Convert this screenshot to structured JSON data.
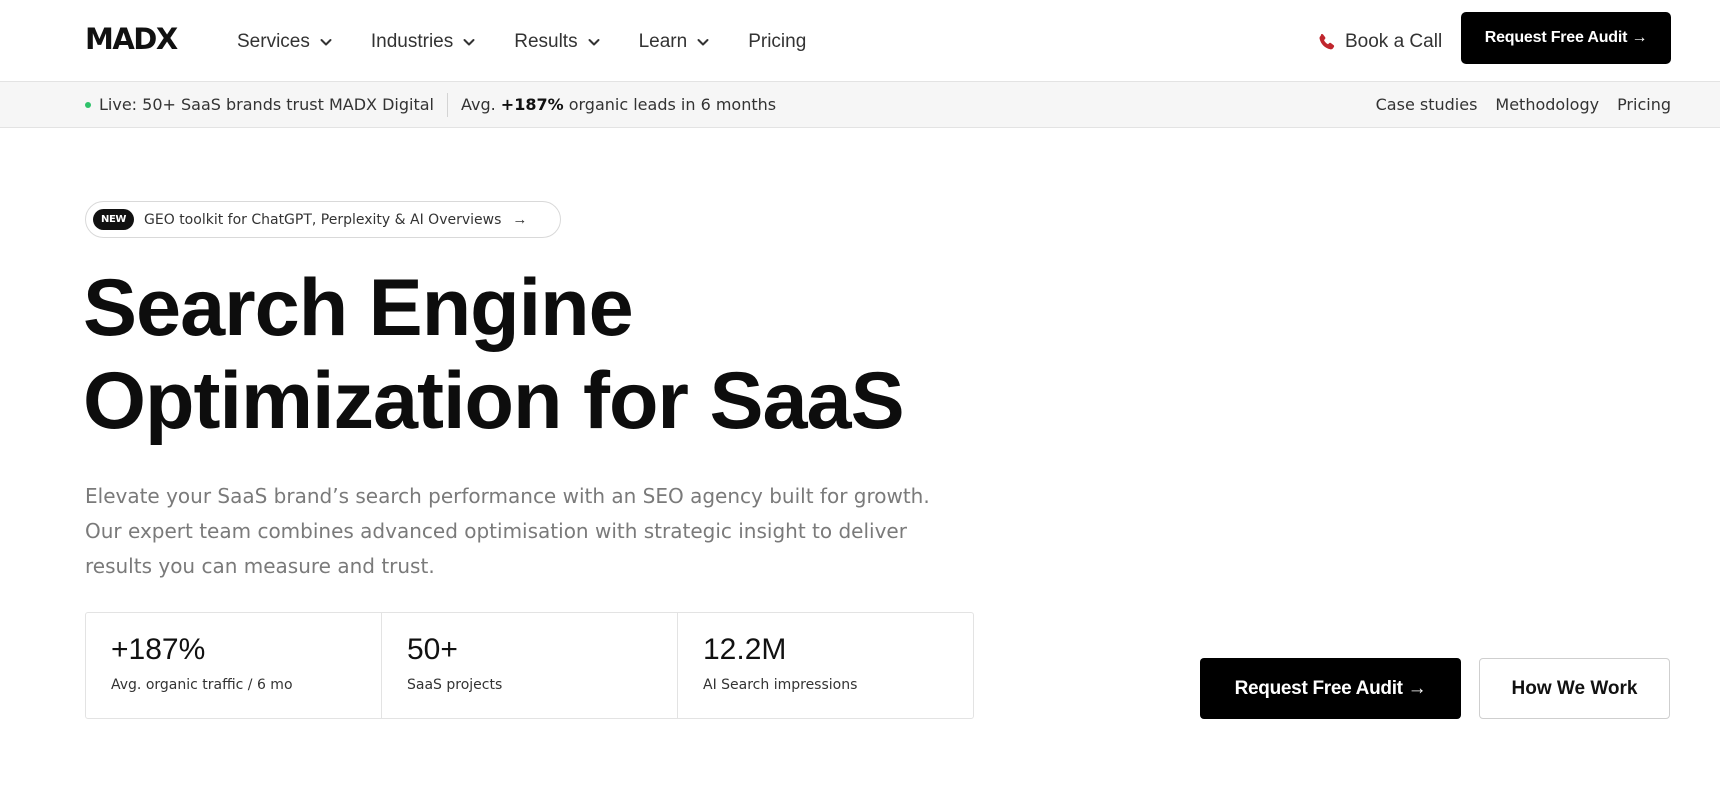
{
  "nav": {
    "logo": "MADX",
    "items": [
      {
        "label": "Services",
        "has_dropdown": true
      },
      {
        "label": "Industries",
        "has_dropdown": true
      },
      {
        "label": "Results",
        "has_dropdown": true
      },
      {
        "label": "Learn",
        "has_dropdown": true
      },
      {
        "label": "Pricing",
        "has_dropdown": false
      }
    ],
    "book_call": "Book a Call",
    "book_call_icon": "phone-icon",
    "cta": "Request Free Audit →"
  },
  "subbar": {
    "live_text": "Live: 50+ SaaS brands trust MADX Digital",
    "avg_prefix": "Avg.",
    "avg_value": "+187%",
    "avg_suffix": "organic leads in 6 months",
    "links": [
      "Case studies",
      "Methodology",
      "Pricing"
    ],
    "live_color": "#2ec26a"
  },
  "hero": {
    "badge": "NEW",
    "pill_text": "GEO toolkit for ChatGPT, Perplexity & AI Overviews",
    "pill_arrow": "→",
    "title_line1": "Search Engine",
    "title_line2": "Optimization for SaaS",
    "description_lines": [
      "Elevate your SaaS brand’s search performance with an SEO agency built for growth.",
      "Our expert team combines advanced optimisation with strategic insight to deliver",
      "results you can measure and trust."
    ],
    "stats": [
      {
        "value": "+187%",
        "label": "Avg. organic traffic / 6 mo"
      },
      {
        "value": "50+",
        "label": "SaaS projects"
      },
      {
        "value": "12.2M",
        "label": "AI Search impressions"
      }
    ],
    "cta_primary": "Request Free Audit →",
    "cta_secondary": "How We Work"
  },
  "colors": {
    "accent": "#000000",
    "phone_icon": "#c0262d",
    "muted_text": "#7a7a7a"
  }
}
